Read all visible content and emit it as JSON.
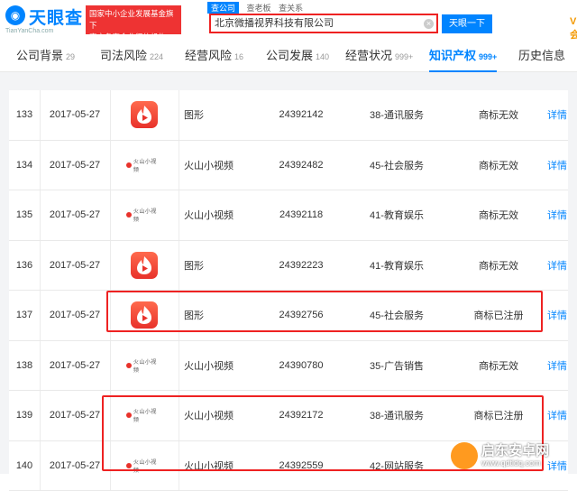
{
  "header": {
    "logo_text": "天眼查",
    "logo_sub": "TianYanCha.com",
    "banner_line1": "国家中小企业发展基金旗下",
    "banner_line2": "官方备案企业征信机构",
    "search_tabs": [
      "查公司",
      "查老板",
      "查关系"
    ],
    "search_value": "北京微播视界科技有限公司",
    "search_button": "天眼一下",
    "vip_label": "VIP会员"
  },
  "tabs": [
    {
      "label": "公司背景",
      "count": "29"
    },
    {
      "label": "司法风险",
      "count": "224"
    },
    {
      "label": "经营风险",
      "count": "16"
    },
    {
      "label": "公司发展",
      "count": "140"
    },
    {
      "label": "经营状况",
      "count": "999+"
    },
    {
      "label": "知识产权",
      "count": "999+",
      "active": true
    },
    {
      "label": "历史信息",
      "count": ""
    }
  ],
  "trademarks": [
    {
      "idx": "133",
      "date": "2017-05-27",
      "icon": "flame-icon",
      "name": "图形",
      "reg_no": "24392142",
      "category": "38-通讯服务",
      "status": "商标无效",
      "action": "详情"
    },
    {
      "idx": "134",
      "date": "2017-05-27",
      "icon": "wordmark-icon",
      "name": "火山小视频",
      "reg_no": "24392482",
      "category": "45-社会服务",
      "status": "商标无效",
      "action": "详情"
    },
    {
      "idx": "135",
      "date": "2017-05-27",
      "icon": "wordmark-icon",
      "name": "火山小视频",
      "reg_no": "24392118",
      "category": "41-教育娱乐",
      "status": "商标无效",
      "action": "详情"
    },
    {
      "idx": "136",
      "date": "2017-05-27",
      "icon": "flame-icon",
      "name": "图形",
      "reg_no": "24392223",
      "category": "41-教育娱乐",
      "status": "商标无效",
      "action": "详情"
    },
    {
      "idx": "137",
      "date": "2017-05-27",
      "icon": "flame-icon",
      "name": "图形",
      "reg_no": "24392756",
      "category": "45-社会服务",
      "status": "商标已注册",
      "action": "详情"
    },
    {
      "idx": "138",
      "date": "2017-05-27",
      "icon": "wordmark-icon",
      "name": "火山小视频",
      "reg_no": "24390780",
      "category": "35-广告销售",
      "status": "商标无效",
      "action": "详情"
    },
    {
      "idx": "139",
      "date": "2017-05-27",
      "icon": "wordmark-icon",
      "name": "火山小视频",
      "reg_no": "24392172",
      "category": "38-通讯服务",
      "status": "商标已注册",
      "action": "详情"
    },
    {
      "idx": "140",
      "date": "2017-05-27",
      "icon": "wordmark-icon",
      "name": "火山小视频",
      "reg_no": "24392559",
      "category": "42-网站服务",
      "status": "",
      "action": "详情"
    }
  ],
  "wordmark_text": "火山小视频",
  "watermark": {
    "line1": "启东安卓网",
    "line2": "www.qdtldq.com"
  },
  "colors": {
    "accent": "#0084ff",
    "highlight": "#ee2222",
    "brand_red": "#e8322b",
    "vip": "#f39800"
  }
}
